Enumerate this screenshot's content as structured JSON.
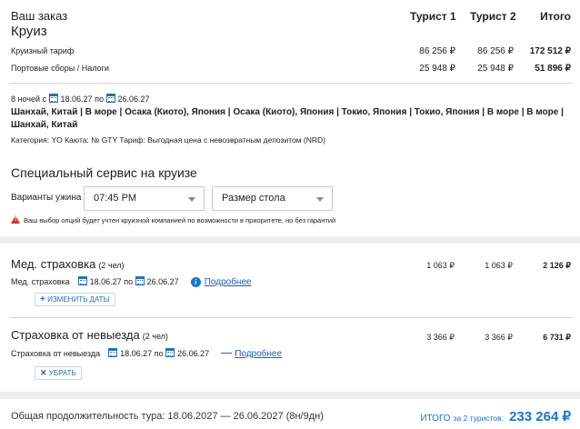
{
  "order": {
    "heading": "Ваш заказ",
    "title": "Круиз",
    "col_headers": [
      "Турист 1",
      "Турист 2",
      "Итого"
    ],
    "rows": [
      {
        "label": "Круизный тариф",
        "t1": "86 256 ₽",
        "t2": "86 256 ₽",
        "total": "172 512 ₽"
      },
      {
        "label": "Портовые сборы / Налоги",
        "t1": "25 948 ₽",
        "t2": "25 948 ₽",
        "total": "51 896 ₽"
      }
    ]
  },
  "itinerary": {
    "nights_prefix": "8 ночей с",
    "date_from": "18.06.27",
    "by": "по",
    "date_to": "26.06.27",
    "route_line1": "Шанхай, Китай | В море | Осака (Киото), Япония | Осака (Киото), Япония | Токио, Япония | Токио, Япония | В море | В море |",
    "route_line2": "Шанхай, Китай",
    "category": "Категория: YO  Каюта: № GTY  Тариф: Выгодная цена с невозвратным депозитом (NRD)"
  },
  "special_service": {
    "title": "Специальный сервис на круизе",
    "dinner_label": "Варианты ужина",
    "dinner_value": "07:45 PM",
    "table_value": "Размер стола",
    "warning": "Ваш выбор опций будет учтен круизной компанией по возможности в приоритете, но без гарантий"
  },
  "medical": {
    "title": "Мед. страховка",
    "people": "(2 чел)",
    "t1": "1 063 ₽",
    "t2": "1 063 ₽",
    "total": "2 126 ₽",
    "sub_label": "Мед. страховка",
    "date_from": "18.06.27",
    "by": "по",
    "date_to": "26.06.27",
    "details_link": "Подробнее",
    "change_dates_btn": "ИЗМЕНИТЬ ДАТЫ"
  },
  "cancellation": {
    "title": "Страховка от невыезда",
    "people": "(2 чел)",
    "t1": "3 366 ₽",
    "t2": "3 366 ₽",
    "total": "6 731 ₽",
    "sub_label": "Страховка от невыезда",
    "date_from": "18.06.27",
    "by": "по",
    "date_to": "26.06.27",
    "details_link": "Подробнее",
    "remove_btn": "УБРАТЬ"
  },
  "footer": {
    "duration": "Общая продолжительность тура: 18.06.2027 — 26.06.2027 (8н/9дн)",
    "total_label": "ИТОГО",
    "total_for": "за 2 туристов:",
    "total_value": "233 264 ₽"
  },
  "colors": {
    "accent": "#1e73c8",
    "warning": "#d0342c",
    "band": "#eceef0"
  }
}
